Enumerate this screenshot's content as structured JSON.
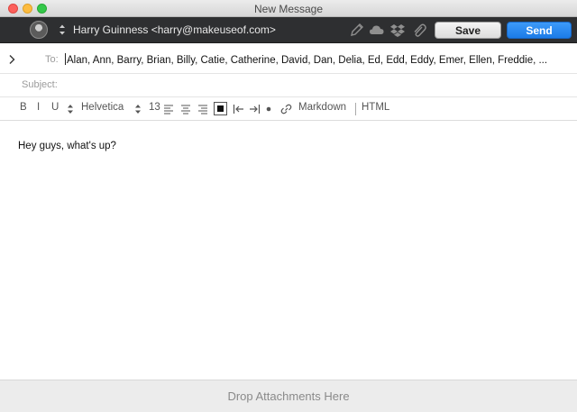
{
  "window": {
    "title": "New Message"
  },
  "toolbar": {
    "from": "Harry Guinness <harry@makeuseof.com>",
    "save_label": "Save",
    "send_label": "Send",
    "icons": [
      "pencil-icon",
      "cloud-icon",
      "dropbox-icon",
      "paperclip-icon"
    ],
    "send_color": "#1b7be8"
  },
  "recipients": {
    "to_label": "To:",
    "to_value": "Alan, Ann, Barry, Brian, Billy, Catie, Catherine, David, Dan, Delia, Ed, Edd, Eddy, Emer, Ellen, Freddie, ...",
    "subject_label": "Subject:",
    "subject_value": ""
  },
  "format_bar": {
    "bold": "B",
    "italic": "I",
    "underline": "U",
    "font": "Helvetica",
    "size": "13",
    "markdown": "Markdown",
    "html": "HTML"
  },
  "message": {
    "body": "Hey guys, what's up?"
  },
  "attachments": {
    "drop_label": "Drop Attachments Here"
  }
}
